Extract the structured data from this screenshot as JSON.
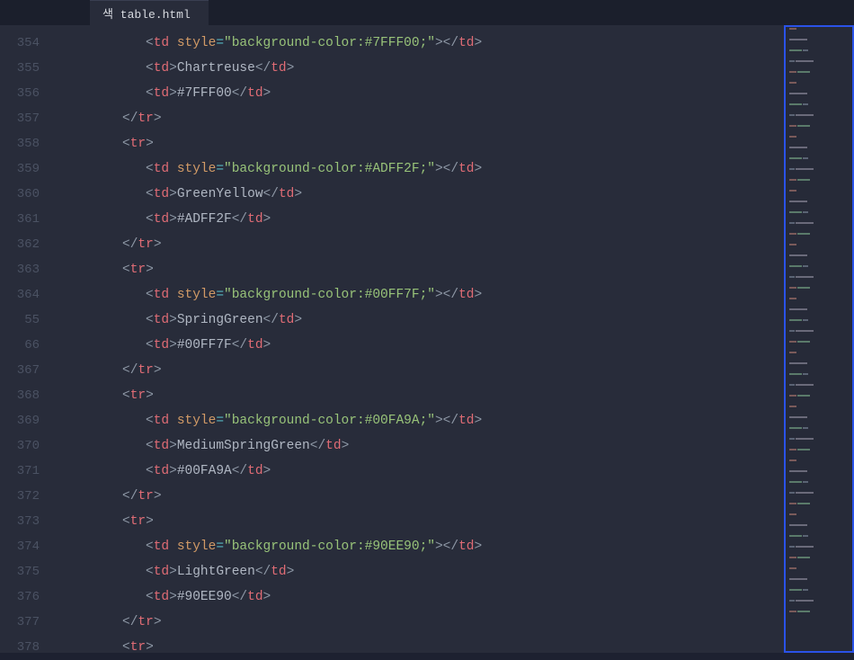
{
  "tab": {
    "title": "색 table.html"
  },
  "gutter": {
    "start": 354,
    "lines": [
      "354",
      "355",
      "356",
      "357",
      "358",
      "359",
      "360",
      "361",
      "362",
      "363",
      "364",
      "55",
      "66",
      "367",
      "368",
      "369",
      "370",
      "371",
      "372",
      "373",
      "374",
      "375",
      "376",
      "377",
      "378"
    ]
  },
  "code": {
    "rows": [
      {
        "indent": 2,
        "type": "td_style",
        "hex": "#7FFF00"
      },
      {
        "indent": 2,
        "type": "td_text",
        "text": "Chartreuse"
      },
      {
        "indent": 2,
        "type": "td_text",
        "text": "#7FFF00"
      },
      {
        "indent": 1,
        "type": "close_tr"
      },
      {
        "indent": 1,
        "type": "open_tr"
      },
      {
        "indent": 2,
        "type": "td_style",
        "hex": "#ADFF2F"
      },
      {
        "indent": 2,
        "type": "td_text",
        "text": "GreenYellow"
      },
      {
        "indent": 2,
        "type": "td_text",
        "text": "#ADFF2F"
      },
      {
        "indent": 1,
        "type": "close_tr"
      },
      {
        "indent": 1,
        "type": "open_tr"
      },
      {
        "indent": 2,
        "type": "td_style",
        "hex": "#00FF7F"
      },
      {
        "indent": 2,
        "type": "td_text",
        "text": "SpringGreen"
      },
      {
        "indent": 2,
        "type": "td_text",
        "text": "#00FF7F"
      },
      {
        "indent": 1,
        "type": "close_tr"
      },
      {
        "indent": 1,
        "type": "open_tr"
      },
      {
        "indent": 2,
        "type": "td_style",
        "hex": "#00FA9A"
      },
      {
        "indent": 2,
        "type": "td_text",
        "text": "MediumSpringGreen"
      },
      {
        "indent": 2,
        "type": "td_text",
        "text": "#00FA9A"
      },
      {
        "indent": 1,
        "type": "close_tr"
      },
      {
        "indent": 1,
        "type": "open_tr"
      },
      {
        "indent": 2,
        "type": "td_style",
        "hex": "#90EE90"
      },
      {
        "indent": 2,
        "type": "td_text",
        "text": "LightGreen"
      },
      {
        "indent": 2,
        "type": "td_text",
        "text": "#90EE90"
      },
      {
        "indent": 1,
        "type": "close_tr"
      },
      {
        "indent": 1,
        "type": "open_tr"
      }
    ],
    "tokens": {
      "td": "td",
      "tr": "tr",
      "style_attr": "style",
      "bg_prefix": "\"background-color:",
      "bg_suffix": ";\""
    }
  }
}
